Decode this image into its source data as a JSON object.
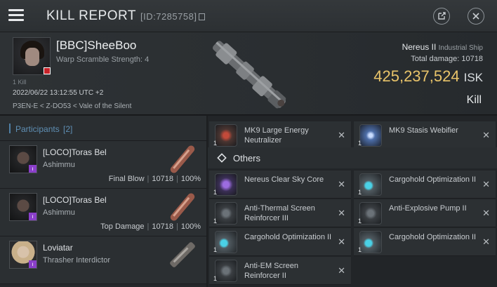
{
  "header": {
    "title": "KILL REPORT",
    "kill_id": "[ID:7285758]"
  },
  "victim": {
    "name": "[BBC]SheeBoo",
    "warp_scramble": "Warp Scramble Strength: 4",
    "kills_label": "1 Kill",
    "datetime": "2022/06/22 13:12:55 UTC +2",
    "location": "P3EN-E < Z-DO53 < Vale of the Silent",
    "ship_name": "Nereus II",
    "ship_class": "Industrial Ship",
    "total_damage_label": "Total damage:",
    "total_damage": "10718",
    "isk_value": "425,237,524",
    "isk_unit": "ISK",
    "result": "Kill"
  },
  "participants": {
    "label": "Participants",
    "count": "[2]",
    "rows": [
      {
        "name": "[LOCO]Toras Bel",
        "ship": "Ashimmu",
        "role": "Final Blow",
        "damage": "10718",
        "percent": "100%"
      },
      {
        "name": "[LOCO]Toras Bel",
        "ship": "Ashimmu",
        "role": "Top Damage",
        "damage": "10718",
        "percent": "100%"
      },
      {
        "name": "Loviatar",
        "ship": "Thrasher Interdictor"
      }
    ]
  },
  "fitted": [
    {
      "name": "MK9 Large Energy Neutralizer",
      "qty": "1"
    },
    {
      "name": "MK9 Stasis Webifier",
      "qty": "1"
    }
  ],
  "others": {
    "label": "Others",
    "items": [
      {
        "name": "Nereus Clear Sky Core",
        "qty": "1"
      },
      {
        "name": "Cargohold Optimization II",
        "qty": "1"
      },
      {
        "name": "Anti-Thermal Screen Reinforcer III",
        "qty": "1"
      },
      {
        "name": "Anti-Explosive Pump II",
        "qty": "1"
      },
      {
        "name": "Cargohold Optimization II",
        "qty": "1"
      },
      {
        "name": "Cargohold Optimization II",
        "qty": "1"
      },
      {
        "name": "Anti-EM Screen Reinforcer II",
        "qty": "1"
      }
    ]
  },
  "close_glyph": "✕"
}
